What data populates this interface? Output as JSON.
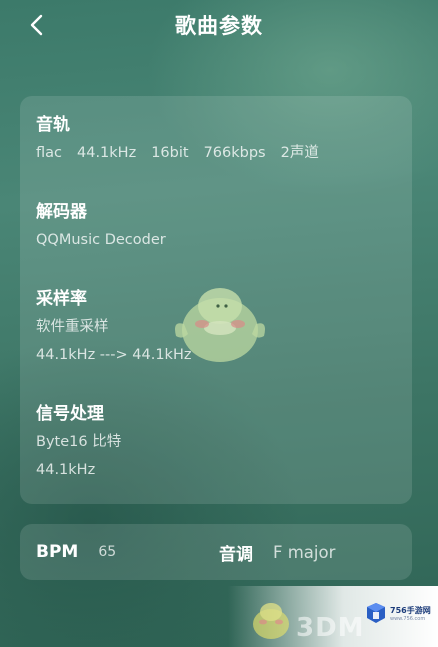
{
  "header": {
    "title": "歌曲参数",
    "back_icon": "chevron-left-icon"
  },
  "audio_track": {
    "title": "音轨",
    "format": "flac",
    "sample_rate": "44.1kHz",
    "bit_depth": "16bit",
    "bitrate": "766kbps",
    "channels": "2声道"
  },
  "decoder": {
    "title": "解码器",
    "value": "QQMusic Decoder"
  },
  "sampling": {
    "title": "采样率",
    "mode": "软件重采样",
    "conversion": "44.1kHz ---> 44.1kHz"
  },
  "signal": {
    "title": "信号处理",
    "bit_label": "Byte16 比特",
    "rate": "44.1kHz"
  },
  "bottom": {
    "bpm_label": "BPM",
    "bpm_value": "65",
    "key_label": "音调",
    "key_value": "F major"
  },
  "watermark": {
    "text": "3DM",
    "brand": "756手游网",
    "url": "www.756.com",
    "mascot_icon": "bird-mascot-icon"
  },
  "colors": {
    "background": "#3f7b6b",
    "card": "rgba(255,255,255,0.12)",
    "text": "#ffffff"
  }
}
